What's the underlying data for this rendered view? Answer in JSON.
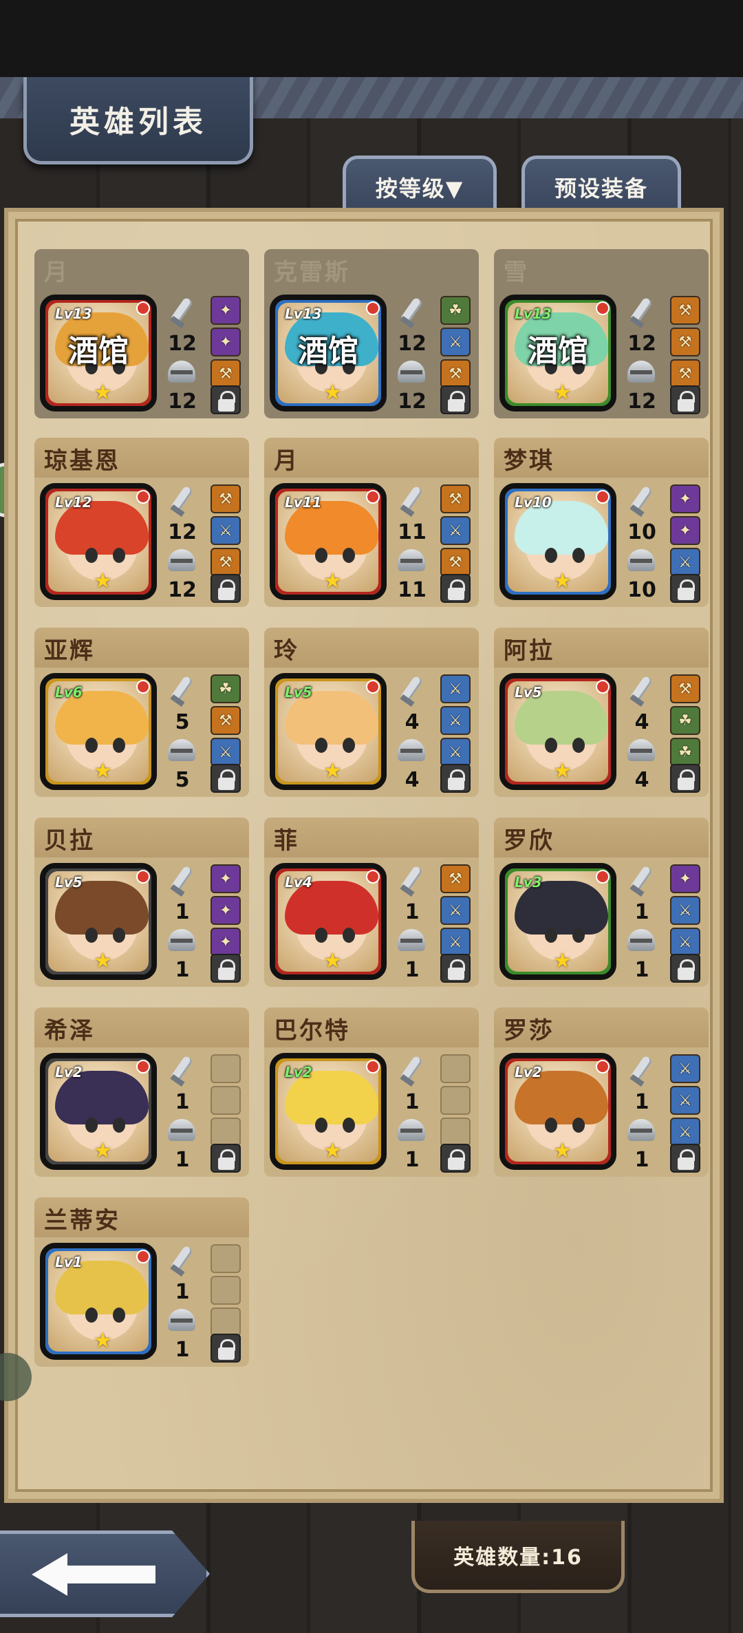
{
  "header": {
    "title": "英雄列表"
  },
  "tabs": {
    "sort_label": "按等级▼",
    "preset_label": "预设装备"
  },
  "footer": {
    "hero_count": "英雄数量:16"
  },
  "tavern_overlay": "酒馆",
  "heroes": [
    {
      "name": "月",
      "level": "Lv13",
      "atk": "12",
      "def": "12",
      "frame": "red",
      "in_tavern": true,
      "equip": [
        "purple",
        "purple",
        "orange"
      ]
    },
    {
      "name": "克雷斯",
      "level": "Lv13",
      "atk": "12",
      "def": "12",
      "frame": "blue",
      "in_tavern": true,
      "equip": [
        "green",
        "blue",
        "orange"
      ]
    },
    {
      "name": "雪",
      "level": "Lv13",
      "atk": "12",
      "def": "12",
      "frame": "green",
      "in_tavern": true,
      "equip": [
        "orange",
        "orange",
        "orange"
      ]
    },
    {
      "name": "琼基恩",
      "level": "Lv12",
      "atk": "12",
      "def": "12",
      "frame": "red",
      "in_tavern": false,
      "equip": [
        "orange",
        "blue",
        "orange"
      ]
    },
    {
      "name": "月",
      "level": "Lv11",
      "atk": "11",
      "def": "11",
      "frame": "red",
      "in_tavern": false,
      "equip": [
        "orange",
        "blue",
        "orange"
      ]
    },
    {
      "name": "梦琪",
      "level": "Lv10",
      "atk": "10",
      "def": "10",
      "frame": "blue",
      "in_tavern": false,
      "equip": [
        "purple",
        "purple",
        "blue"
      ]
    },
    {
      "name": "亚辉",
      "level": "Lv6",
      "atk": "5",
      "def": "5",
      "frame": "gold",
      "in_tavern": false,
      "equip": [
        "green",
        "orange",
        "blue"
      ]
    },
    {
      "name": "玲",
      "level": "Lv5",
      "atk": "4",
      "def": "4",
      "frame": "gold",
      "in_tavern": false,
      "equip": [
        "blue",
        "blue",
        "blue"
      ]
    },
    {
      "name": "阿拉",
      "level": "Lv5",
      "atk": "4",
      "def": "4",
      "frame": "red",
      "in_tavern": false,
      "equip": [
        "orange",
        "green",
        "green"
      ]
    },
    {
      "name": "贝拉",
      "level": "Lv5",
      "atk": "1",
      "def": "1",
      "frame": "dark",
      "in_tavern": false,
      "equip": [
        "purple",
        "purple",
        "purple"
      ]
    },
    {
      "name": "菲",
      "level": "Lv4",
      "atk": "1",
      "def": "1",
      "frame": "red",
      "in_tavern": false,
      "equip": [
        "orange",
        "blue",
        "blue"
      ]
    },
    {
      "name": "罗欣",
      "level": "Lv3",
      "atk": "1",
      "def": "1",
      "frame": "green",
      "in_tavern": false,
      "equip": [
        "purple",
        "blue",
        "blue"
      ]
    },
    {
      "name": "希泽",
      "level": "Lv2",
      "atk": "1",
      "def": "1",
      "frame": "dark",
      "in_tavern": false,
      "equip": [
        "empty",
        "empty",
        "empty"
      ]
    },
    {
      "name": "巴尔特",
      "level": "Lv2",
      "atk": "1",
      "def": "1",
      "frame": "gold",
      "in_tavern": false,
      "equip": [
        "empty",
        "empty",
        "empty"
      ]
    },
    {
      "name": "罗莎",
      "level": "Lv2",
      "atk": "1",
      "def": "1",
      "frame": "red",
      "in_tavern": false,
      "equip": [
        "blue",
        "blue",
        "blue"
      ]
    },
    {
      "name": "兰蒂安",
      "level": "Lv1",
      "atk": "1",
      "def": "1",
      "frame": "blue",
      "in_tavern": false,
      "equip": [
        "empty",
        "empty",
        "empty"
      ]
    }
  ]
}
